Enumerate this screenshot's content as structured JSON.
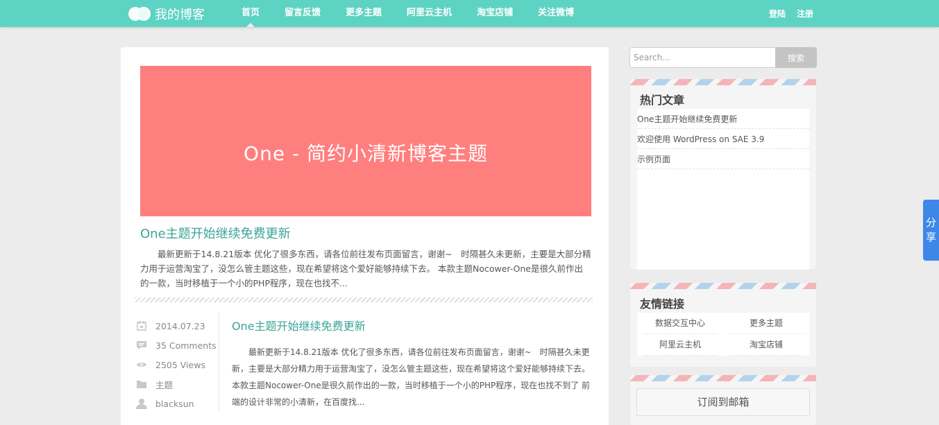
{
  "site": {
    "title": "我的博客"
  },
  "nav": {
    "items": [
      {
        "label": "首页"
      },
      {
        "label": "留言反馈"
      },
      {
        "label": "更多主题"
      },
      {
        "label": "阿里云主机"
      },
      {
        "label": "淘宝店铺"
      },
      {
        "label": "关注微博"
      }
    ],
    "active_index": 0,
    "login": "登陆",
    "register": "注册"
  },
  "banner": {
    "text": "One - 简约小清新博客主题"
  },
  "featured_post": {
    "title": "One主题开始继续免费更新",
    "excerpt": "最新更新于14.8.21版本 优化了很多东西，请各位前往发布页面留言，谢谢~　时隔甚久未更新，主要是大部分精力用于运营淘宝了，没怎么管主题这些，现在希望将这个爱好能够持续下去。 本款主题Nocower-One是很久前作出的一款，当时移植于一个小的PHP程序，现在也找不..."
  },
  "post": {
    "date": "2014.07.23",
    "comments": "35 Comments",
    "views": "2505 Views",
    "category": "主题",
    "author": "blacksun",
    "title": "One主题开始继续免费更新",
    "excerpt": "最新更新于14.8.21版本 优化了很多东西，请各位前往发布页面留言，谢谢~　时隔甚久未更新，主要是大部分精力用于运营淘宝了，没怎么管主题这些，现在希望将这个爱好能够持续下去。 本款主题Nocower-One是很久前作出的一款，当时移植于一个小的PHP程序，现在也找不到了 前端的设计非常的小清新，在百度找..."
  },
  "search": {
    "placeholder": "Search...",
    "button": "搜索"
  },
  "hot_articles": {
    "title": "热门文章",
    "items": [
      {
        "label": "One主题开始继续免费更新"
      },
      {
        "label": "欢迎使用 WordPress on SAE 3.9"
      },
      {
        "label": "示例页面"
      }
    ]
  },
  "friend_links": {
    "title": "友情链接",
    "items": [
      {
        "label": "数据交互中心"
      },
      {
        "label": "更多主题"
      },
      {
        "label": "阿里云主机"
      },
      {
        "label": "淘宝店铺"
      }
    ]
  },
  "subscribe": {
    "label": "订阅到邮箱"
  },
  "share": {
    "label": "分享"
  },
  "colors": {
    "accent": "#5dd3c3",
    "banner": "#ff7f7f",
    "link": "#3aa496",
    "share": "#3e87e8"
  }
}
